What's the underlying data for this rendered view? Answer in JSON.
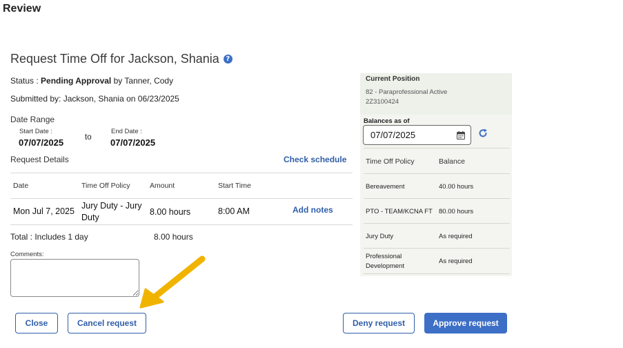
{
  "header": {
    "title": "Review"
  },
  "page": {
    "title": "Request Time Off for Jackson, Shania",
    "help_icon": "?"
  },
  "status": {
    "label": "Status : ",
    "value": "Pending Approval",
    "suffix": " by Tanner, Cody"
  },
  "submitted": "Submitted by: Jackson, Shania on 06/23/2025",
  "date_range": {
    "label": "Date Range",
    "start_label": "Start Date :",
    "start_value": "07/07/2025",
    "to": "to",
    "end_label": "End Date :",
    "end_value": "07/07/2025"
  },
  "details": {
    "label": "Request Details",
    "check_schedule": "Check schedule",
    "columns": [
      "Date",
      "Time Off Policy",
      "Amount",
      "Start Time"
    ],
    "rows": [
      {
        "date": "Mon Jul 7, 2025",
        "policy_line1": "Jury Duty - Jury",
        "policy_line2": "Duty",
        "amount": "8.00 hours",
        "start": "8:00 AM",
        "action": "Add notes"
      }
    ],
    "total_label": "Total : Includes 1 day",
    "total_amount": "8.00 hours"
  },
  "comments": {
    "label": "Comments:",
    "value": ""
  },
  "buttons": {
    "close": "Close",
    "cancel": "Cancel request",
    "deny": "Deny request",
    "approve": "Approve request"
  },
  "panel": {
    "current_position_label": "Current Position",
    "position_line1": "82 - Paraprofessional Active",
    "position_line2": "2Z3100424",
    "balances_label": "Balances as of",
    "balances_date": "07/07/2025",
    "columns": [
      "Time Off Policy",
      "Balance"
    ],
    "rows": [
      {
        "policy": "Bereavement",
        "balance": "40.00 hours"
      },
      {
        "policy": "PTO - TEAM/KCNA FT",
        "balance": "80.00 hours"
      },
      {
        "policy": "Jury Duty",
        "balance": "As required"
      },
      {
        "policy_line1": "Professional",
        "policy_line2": "Development",
        "balance": "As required"
      }
    ]
  },
  "colors": {
    "accent": "#3d6fc7",
    "link": "#2f5ea8",
    "arrow": "#f0b400"
  }
}
